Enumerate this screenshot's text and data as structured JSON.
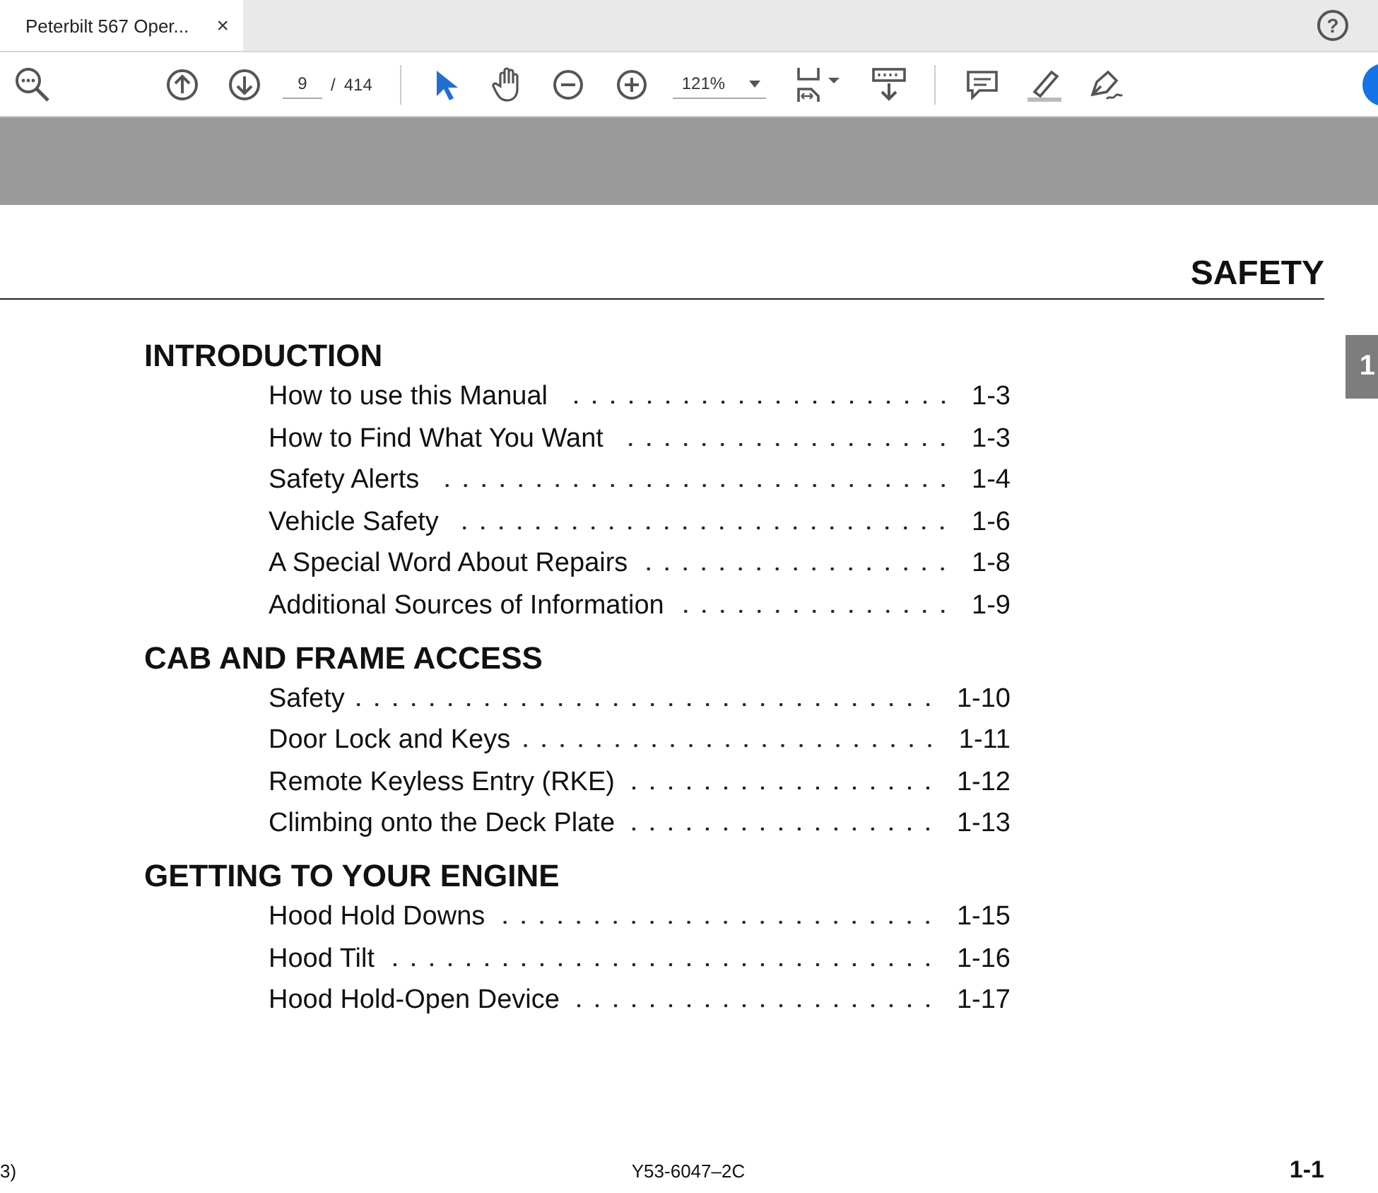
{
  "tab": {
    "title": "Peterbilt 567 Oper...",
    "close": "×",
    "selected": true
  },
  "help": "?",
  "toolbar": {
    "page": "9",
    "separator": "/",
    "total": "414",
    "zoom": "121%"
  },
  "page": {
    "heading": "SAFETY",
    "side_tab": "1",
    "sections": [
      {
        "title": "INTRODUCTION",
        "entries": [
          {
            "title": "How to use this Manual",
            "page": "1-3"
          },
          {
            "title": "How to Find What You Want",
            "page": "1-3"
          },
          {
            "title": "Safety Alerts",
            "page": "1-4"
          },
          {
            "title": "Vehicle Safety",
            "page": "1-6"
          },
          {
            "title": "A Special Word About Repairs",
            "page": "1-8"
          },
          {
            "title": "Additional Sources of Information",
            "page": "1-9"
          }
        ]
      },
      {
        "title": "CAB AND FRAME ACCESS",
        "entries": [
          {
            "title": "Safety",
            "page": "1-10"
          },
          {
            "title": "Door Lock and Keys",
            "page": "1-11"
          },
          {
            "title": "Remote Keyless Entry (RKE)",
            "page": "1-12"
          },
          {
            "title": "Climbing onto the Deck Plate",
            "page": "1-13"
          }
        ]
      },
      {
        "title": "GETTING TO YOUR ENGINE",
        "entries": [
          {
            "title": "Hood Hold Downs",
            "page": "1-15"
          },
          {
            "title": "Hood Tilt",
            "page": "1-16"
          },
          {
            "title": "Hood Hold-Open Device",
            "page": "1-17"
          }
        ]
      }
    ],
    "footer": {
      "left": "3)",
      "center": "Y53-6047–2C",
      "right": "1-1"
    }
  }
}
